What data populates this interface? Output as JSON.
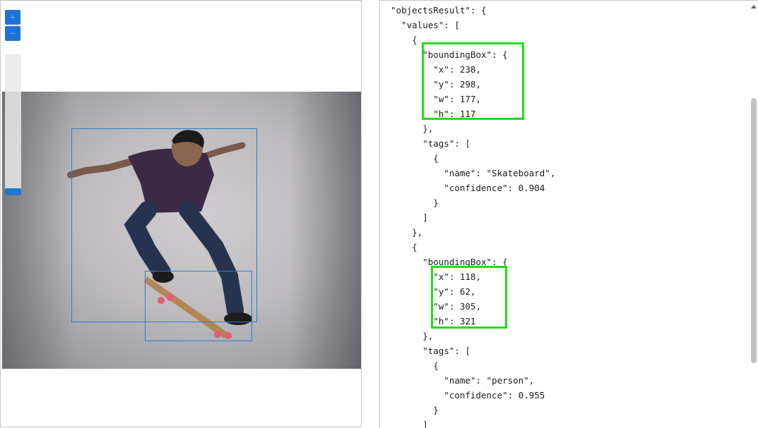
{
  "viewer": {
    "zoom_in_label": "+",
    "zoom_out_label": "−",
    "zoom_level": 0.0,
    "image_description": "skateboarder"
  },
  "json_lines": [
    "  \"objectsResult\": {",
    "    \"values\": [",
    "      {",
    "        \"boundingBox\": {",
    "          \"x\": 238,",
    "          \"y\": 298,",
    "          \"w\": 177,",
    "          \"h\": 117",
    "        },",
    "        \"tags\": [",
    "          {",
    "            \"name\": \"Skateboard\",",
    "            \"confidence\": 0.904",
    "          }",
    "        ]",
    "      },",
    "      {",
    "        \"boundingBox\": {",
    "          \"x\": 118,",
    "          \"y\": 62,",
    "          \"w\": 305,",
    "          \"h\": 321",
    "        },",
    "        \"tags\": [",
    "          {",
    "            \"name\": \"person\",",
    "            \"confidence\": 0.955",
    "          }",
    "        ]"
  ],
  "colors": {
    "highlight": "#22dd11",
    "bbox": "#2a7fd4",
    "zoom_button": "#1e73d2"
  }
}
